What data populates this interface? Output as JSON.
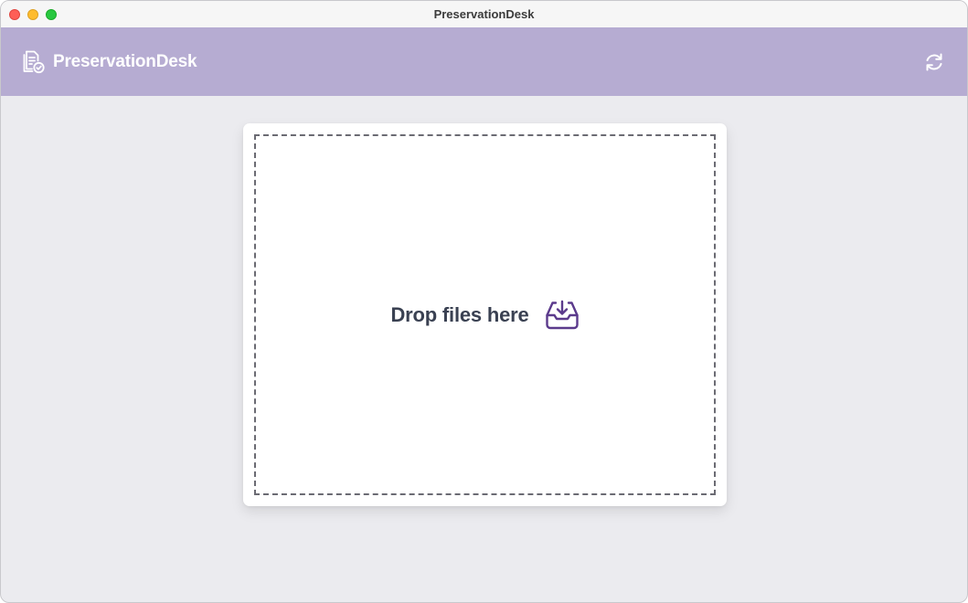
{
  "window": {
    "title": "PreservationDesk"
  },
  "header": {
    "app_name": "PreservationDesk",
    "logo_icon": "document-check-icon",
    "refresh_icon": "refresh-icon",
    "background_color": "#b6acd2"
  },
  "dropzone": {
    "label": "Drop files here",
    "icon": "inbox-download-icon",
    "accent_color": "#5b3a8c"
  }
}
